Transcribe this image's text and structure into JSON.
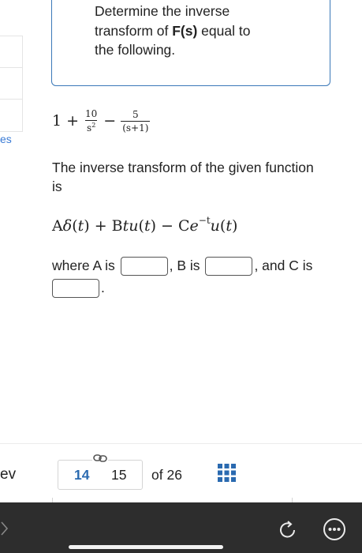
{
  "sidebar": {
    "partial_label": "es"
  },
  "question": {
    "prompt_line1": "Determine the inverse",
    "prompt_line2_pre": "transform of ",
    "prompt_line2_bold": "F(s)",
    "prompt_line2_post": " equal to",
    "prompt_line3": "the following.",
    "formula": {
      "one": "1",
      "plus": "+",
      "frac1_num": "10",
      "frac1_den": "s",
      "frac1_den_exp": "2",
      "minus": "−",
      "frac2_num": "5",
      "frac2_den": "(s+1)"
    },
    "explain": "The inverse transform of the given function is",
    "result": {
      "p1": "A",
      "delta": "δ",
      "p2": "(",
      "t1": "t",
      "p3": ") + B",
      "t2": "t",
      "u1": "u",
      "p4": "(",
      "t3": "t",
      "p5": ") − C",
      "e": "e",
      "exp": "−t",
      "u2": "u",
      "p6": "(",
      "t4": "t",
      "p7": ")"
    },
    "where_a": "where A is",
    "where_b": ", B is",
    "where_c": ", and C is",
    "end_period": "."
  },
  "pager": {
    "prev_label": "ev",
    "current_page": "14",
    "next_page": "15",
    "of_label": "of 26"
  },
  "icons": {
    "link": "link-icon",
    "grid": "grid-icon",
    "refresh": "refresh-icon",
    "more": "more-icon",
    "chevron": "chevron-right-icon"
  },
  "colors": {
    "accent": "#2a6ab0",
    "box_border": "#3a78b8",
    "bottom_bar": "#2d2d2d"
  }
}
